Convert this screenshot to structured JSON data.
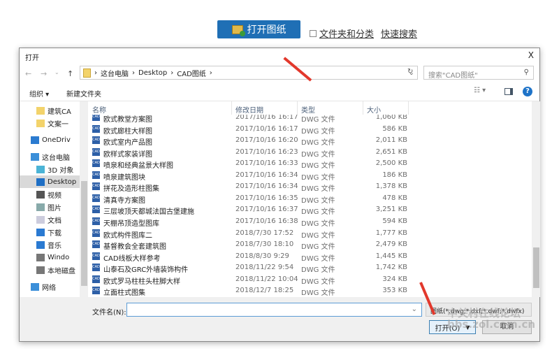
{
  "top": {
    "open_button": "打开图纸",
    "checkbox_label": "文件夹和分类",
    "quick_search": "快速搜索"
  },
  "dialog": {
    "title": "打开",
    "close": "X",
    "breadcrumb": [
      "这台电脑",
      "Desktop",
      "CAD图纸"
    ],
    "search_placeholder": "搜索\"CAD图纸\"",
    "toolbar": {
      "organize": "组织 ▾",
      "new_folder": "新建文件夹"
    },
    "sidebar": [
      {
        "label": "建筑CA",
        "icon": "folder-icon"
      },
      {
        "label": "文案一",
        "icon": "folder-icon"
      },
      {
        "label": "OneDriv",
        "icon": "cloud-icon"
      },
      {
        "label": "这台电脑",
        "icon": "computer-icon"
      },
      {
        "label": "3D 对象",
        "icon": "cube-icon"
      },
      {
        "label": "Desktop",
        "icon": "desktop-icon",
        "selected": true
      },
      {
        "label": "视频",
        "icon": "video-icon"
      },
      {
        "label": "图片",
        "icon": "picture-icon"
      },
      {
        "label": "文档",
        "icon": "document-icon"
      },
      {
        "label": "下载",
        "icon": "download-icon"
      },
      {
        "label": "音乐",
        "icon": "music-icon"
      },
      {
        "label": "Windo",
        "icon": "drive-icon"
      },
      {
        "label": "本地磁盘",
        "icon": "drive-icon"
      },
      {
        "label": "网络",
        "icon": "network-icon"
      }
    ],
    "columns": [
      "名称",
      "修改日期",
      "类型",
      "大小"
    ],
    "files": [
      {
        "name": "欧式教堂方案图",
        "date": "2017/10/16 16:17",
        "type": "DWG 文件",
        "size": "1,060 KB"
      },
      {
        "name": "欧式廊柱大样图",
        "date": "2017/10/16 16:17",
        "type": "DWG 文件",
        "size": "586 KB"
      },
      {
        "name": "欧式室内产品图",
        "date": "2017/10/16 16:20",
        "type": "DWG 文件",
        "size": "2,011 KB"
      },
      {
        "name": "欧样式家装详图",
        "date": "2017/10/16 16:23",
        "type": "DWG 文件",
        "size": "2,651 KB"
      },
      {
        "name": "喷泉和经典盆景大样图",
        "date": "2017/10/16 16:33",
        "type": "DWG 文件",
        "size": "2,500 KB"
      },
      {
        "name": "喷泉建筑图块",
        "date": "2017/10/16 16:34",
        "type": "DWG 文件",
        "size": "186 KB"
      },
      {
        "name": "拼花及造形柱图集",
        "date": "2017/10/16 16:34",
        "type": "DWG 文件",
        "size": "1,378 KB"
      },
      {
        "name": "清真寺方案图",
        "date": "2017/10/16 16:35",
        "type": "DWG 文件",
        "size": "478 KB"
      },
      {
        "name": "三层坡顶天都城法国古堡建施",
        "date": "2017/10/16 16:37",
        "type": "DWG 文件",
        "size": "3,251 KB"
      },
      {
        "name": "天棚吊顶造型图库",
        "date": "2017/10/16 16:38",
        "type": "DWG 文件",
        "size": "594 KB"
      },
      {
        "name": "欧式构件图库二",
        "date": "2018/7/30 17:52",
        "type": "DWG 文件",
        "size": "1,777 KB"
      },
      {
        "name": "基督教会全套建筑图",
        "date": "2018/7/30 18:10",
        "type": "DWG 文件",
        "size": "2,479 KB"
      },
      {
        "name": "CAD线板大样参考",
        "date": "2018/8/30 9:29",
        "type": "DWG 文件",
        "size": "1,445 KB"
      },
      {
        "name": "山泰石及GRC外墙装饰构件",
        "date": "2018/11/22 9:54",
        "type": "DWG 文件",
        "size": "1,742 KB"
      },
      {
        "name": "欧式罗马柱柱头柱脚大样",
        "date": "2018/11/22 10:04",
        "type": "DWG 文件",
        "size": "324 KB"
      },
      {
        "name": "立面柱式图集",
        "date": "2018/12/7 18:25",
        "type": "DWG 文件",
        "size": "353 KB"
      }
    ],
    "filename_label": "文件名(N):",
    "filename_value": "",
    "filetype": "图纸(*.dwg;*.dxf;*.dwf;*.dwfx)",
    "open": "打开(O)",
    "cancel": "取消"
  },
  "watermark": "中关村在线论坛 bbs.zol.com.cn",
  "colors": {
    "accent": "#1f6fb5",
    "arrow": "#e2382c"
  }
}
